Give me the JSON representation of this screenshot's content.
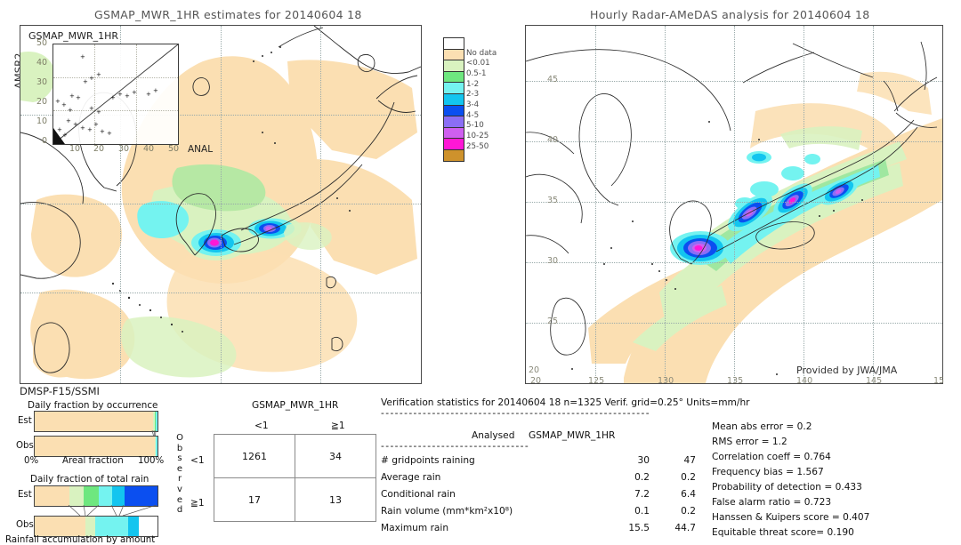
{
  "left_panel": {
    "title": "GSMAP_MWR_1HR estimates for 20140604 18",
    "corner_label": "GSMAP_MWR_1HR",
    "y_axis_label": "AMSR2",
    "bottom_label": "DMSP-F15/SSMI",
    "inset": {
      "x_label": "ANAL",
      "y_ticks": [
        "50",
        "40",
        "30",
        "20",
        "10",
        "0"
      ],
      "x_ticks": [
        "10",
        "20",
        "30",
        "40",
        "50"
      ]
    }
  },
  "right_panel": {
    "title": "Hourly Radar-AMeDAS analysis for 20140604 18",
    "credit": "Provided by JWA/JMA",
    "lat_ticks": [
      "45",
      "40",
      "35",
      "30",
      "25",
      "20"
    ],
    "lon_ticks": [
      "125",
      "130",
      "135",
      "140",
      "145",
      "15"
    ],
    "corner_lat": "20",
    "corner_lon": "20"
  },
  "colorbar": {
    "labels": [
      "No data",
      "<0.01",
      "0.5-1",
      "1-2",
      "2-3",
      "3-4",
      "4-5",
      "5-10",
      "10-25",
      "25-50"
    ],
    "colors": [
      "#ffffff",
      "#fbdfb2",
      "#d9f2c0",
      "#6ee77f",
      "#74f3f0",
      "#13c5ef",
      "#0b4ff0",
      "#8b6ef5",
      "#cf5ff0",
      "#ff17d6",
      "#ce922c"
    ]
  },
  "occurrence_panel": {
    "title": "Daily fraction by occurrence",
    "est_label": "Est",
    "obs_label": "Obs",
    "left_axis": "0%",
    "center_axis": "Areal fraction",
    "right_axis": "100%",
    "est_segments": [
      {
        "color": "#fbdfb2",
        "pct": 96.3
      },
      {
        "color": "#d9f2c0",
        "pct": 1.2
      },
      {
        "color": "#6ee77f",
        "pct": 0.9
      },
      {
        "color": "#74f3f0",
        "pct": 1.6
      }
    ],
    "obs_segments": [
      {
        "color": "#fbdfb2",
        "pct": 97.8
      },
      {
        "color": "#d9f2c0",
        "pct": 0.7
      },
      {
        "color": "#74f3f0",
        "pct": 1.5
      }
    ]
  },
  "amount_panel": {
    "title": "Daily fraction of total rain",
    "caption": "Rainfall accumulation by amount",
    "est_label": "Est",
    "obs_label": "Obs",
    "est_segments": [
      {
        "color": "#fbdfb2",
        "pct": 28.5
      },
      {
        "color": "#d9f2c0",
        "pct": 11.5
      },
      {
        "color": "#6ee77f",
        "pct": 12.5
      },
      {
        "color": "#74f3f0",
        "pct": 10.5
      },
      {
        "color": "#13c5ef",
        "pct": 10.0
      },
      {
        "color": "#0b4ff0",
        "pct": 27.0
      }
    ],
    "obs_segments": [
      {
        "color": "#fbdfb2",
        "pct": 41.0
      },
      {
        "color": "#d9f2c0",
        "pct": 8.0
      },
      {
        "color": "#74f3f0",
        "pct": 27.0
      },
      {
        "color": "#13c5ef",
        "pct": 9.0
      }
    ]
  },
  "contingency": {
    "header": "GSMAP_MWR_1HR",
    "col_headers": [
      "<1",
      "≧1"
    ],
    "row_headers": [
      "<1",
      "≧1"
    ],
    "side_label": "Observed",
    "cells": [
      [
        "1261",
        "34"
      ],
      [
        "17",
        "13"
      ]
    ]
  },
  "stats": {
    "header": "Verification statistics for 20140604 18  n=1325  Verif. grid=0.25°  Units=mm/hr",
    "rule_long": "----------------------------------------------------------",
    "col_a": "Analysed",
    "col_b": "GSMAP_MWR_1HR",
    "rule_short": "--------------------------------",
    "rows": [
      {
        "label": "# gridpoints raining",
        "analysed": "30",
        "gsmap": "47"
      },
      {
        "label": "Average rain",
        "analysed": "0.2",
        "gsmap": "0.2"
      },
      {
        "label": "Conditional rain",
        "analysed": "7.2",
        "gsmap": "6.4"
      },
      {
        "label": "Rain volume (mm*km²x10⁸)",
        "analysed": "0.1",
        "gsmap": "0.2"
      },
      {
        "label": "Maximum rain",
        "analysed": "15.5",
        "gsmap": "44.7"
      }
    ],
    "metrics": [
      "Mean abs error = 0.2",
      "RMS error = 1.2",
      "Correlation coeff = 0.764",
      "Frequency bias = 1.567",
      "Probability of detection = 0.433",
      "False alarm ratio = 0.723",
      "Hanssen & Kuipers score = 0.407",
      "Equitable threat score= 0.190"
    ]
  }
}
